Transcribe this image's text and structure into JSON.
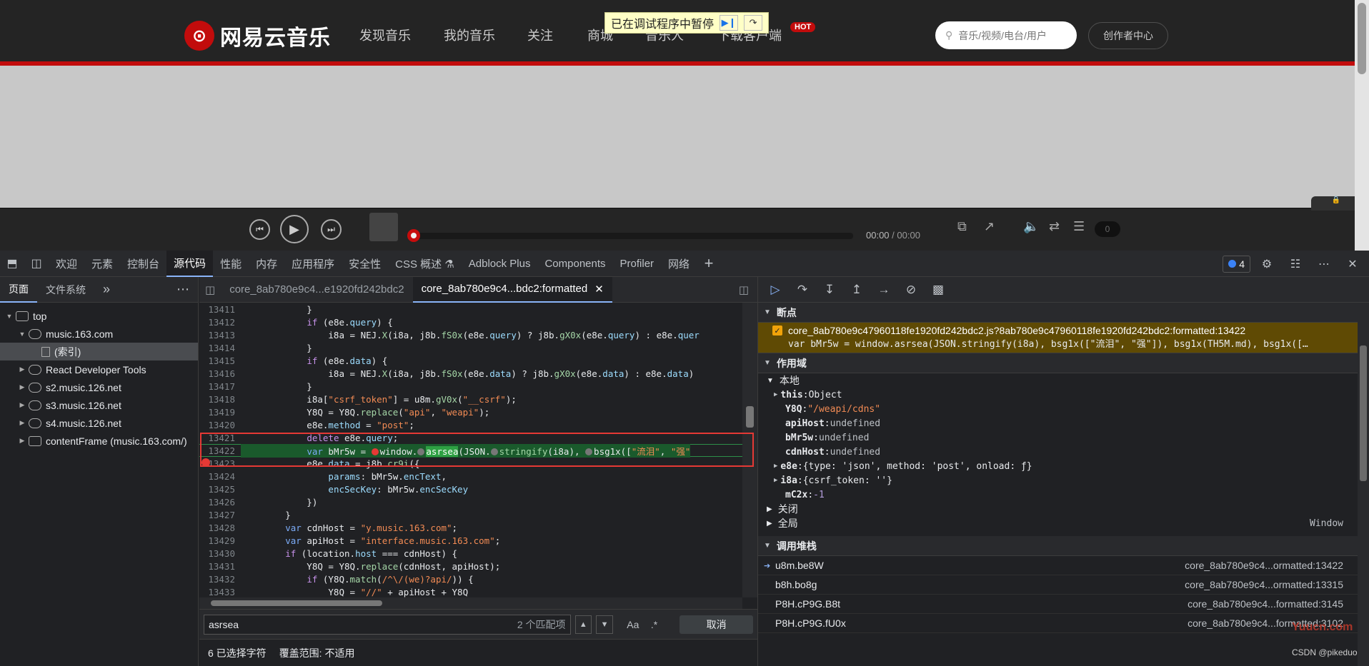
{
  "site": {
    "logo_text": "网易云音乐",
    "logo_mark": "⊙",
    "nav": [
      "发现音乐",
      "我的音乐",
      "关注",
      "商城",
      "音乐人",
      "下载客户端"
    ],
    "hot_badge": "HOT",
    "search_placeholder": "音乐/视频/电台/用户",
    "creator_center": "创作者中心",
    "paused_banner": "已在调试程序中暂停",
    "player": {
      "time_current": "00:00",
      "time_total": "/ 00:00",
      "playlist_count": "0",
      "progress": 0
    },
    "accent": "#c20c0c"
  },
  "devtools": {
    "main_tabs": [
      "欢迎",
      "元素",
      "控制台",
      "源代码",
      "性能",
      "内存",
      "应用程序",
      "安全性",
      "CSS 概述 ⚗",
      "Adblock Plus",
      "Components",
      "Profiler",
      "网络"
    ],
    "active_tab": "源代码",
    "issues_count": "4",
    "navigator": {
      "tabs": [
        "页面",
        "文件系统"
      ],
      "tree": [
        {
          "label": "top",
          "level": 0,
          "icon": "frame"
        },
        {
          "label": "music.163.com",
          "level": 1,
          "icon": "cloud"
        },
        {
          "label": "(索引)",
          "level": 2,
          "icon": "file"
        },
        {
          "label": "React Developer Tools",
          "level": 1,
          "icon": "cloud"
        },
        {
          "label": "s2.music.126.net",
          "level": 1,
          "icon": "cloud"
        },
        {
          "label": "s3.music.126.net",
          "level": 1,
          "icon": "cloud"
        },
        {
          "label": "s4.music.126.net",
          "level": 1,
          "icon": "cloud"
        },
        {
          "label": "contentFrame (music.163.com/)",
          "level": 1,
          "icon": "frame"
        }
      ]
    },
    "editor": {
      "tabs": [
        "core_8ab780e9c4...e1920fd242bdc2",
        "core_8ab780e9c4...bdc2:formatted"
      ],
      "active_tab_index": 1,
      "line_numbers": [
        "13411",
        "13412",
        "13413",
        "13414",
        "13415",
        "13416",
        "13417",
        "13418",
        "13419",
        "13420",
        "13421",
        "13422",
        "13423",
        "13424",
        "13425",
        "13426",
        "13427",
        "13428",
        "13429",
        "13430",
        "13431",
        "13432",
        "13433"
      ],
      "search_query": "asrsea",
      "match_count": "2 个匹配项",
      "cancel": "取消",
      "status_selected": "6 已选择字符",
      "status_coverage": "覆盖范围: 不适用"
    },
    "debugger": {
      "breakpoints_title": "断点",
      "breakpoint_file": "core_8ab780e9c47960118fe1920fd242bdc2.js?8ab780e9c47960118fe1920fd242bdc2:formatted:13422",
      "breakpoint_code": "var bMr5w = window.asrsea(JSON.stringify(i8a), bsg1x([\"流泪\", \"强\"]), bsg1x(TH5M.md), bsg1x([…",
      "scope_title": "作用域",
      "scope_local": "本地",
      "scope_vars": [
        {
          "k": "this",
          "v": "Object",
          "t": "obj",
          "expandable": true
        },
        {
          "k": "Y8Q",
          "v": "\"/weapi/cdns\"",
          "t": "str",
          "expandable": false
        },
        {
          "k": "apiHost",
          "v": "undefined",
          "t": "undef",
          "expandable": false
        },
        {
          "k": "bMr5w",
          "v": "undefined",
          "t": "undef",
          "expandable": false
        },
        {
          "k": "cdnHost",
          "v": "undefined",
          "t": "undef",
          "expandable": false
        },
        {
          "k": "e8e",
          "v": "{type: 'json', method: 'post', onload: ƒ}",
          "t": "obj",
          "expandable": true
        },
        {
          "k": "i8a",
          "v": "{csrf_token: ''}",
          "t": "obj",
          "expandable": true
        },
        {
          "k": "mC2x",
          "v": "-1",
          "t": "num",
          "expandable": false
        }
      ],
      "scope_closure": "关闭",
      "scope_global": "全局",
      "scope_global_value": "Window",
      "callstack_title": "调用堆栈",
      "callstack": [
        {
          "name": "u8m.be8W",
          "loc": "core_8ab780e9c4...ormatted:13422"
        },
        {
          "name": "b8h.bo8g",
          "loc": "core_8ab780e9c4...ormatted:13315"
        },
        {
          "name": "P8H.cP9G.B8t",
          "loc": "core_8ab780e9c4...formatted:3145"
        },
        {
          "name": "P8H.cP9G.fU0x",
          "loc": "core_8ab780e9c4...formatted:3102"
        }
      ]
    },
    "watermark_red": "Yuucn.com",
    "watermark_csdn": "CSDN @pikeduo"
  }
}
